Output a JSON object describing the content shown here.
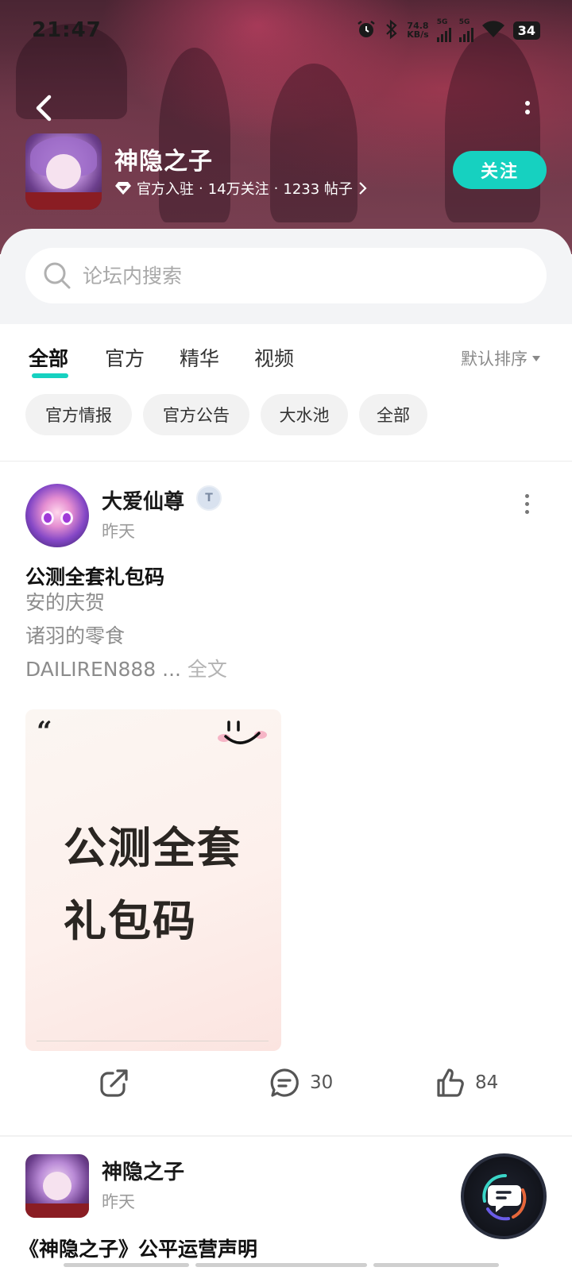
{
  "status_bar": {
    "time": "21:47",
    "net_speed_value": "74.8",
    "net_speed_unit": "KB/s",
    "sim1": "5G",
    "sim2": "5G",
    "battery": "34",
    "icons": [
      "alarm-icon",
      "bluetooth-icon",
      "signal-icon",
      "wifi-icon",
      "battery-icon"
    ]
  },
  "header": {
    "back_icon": "chevron-left-icon",
    "more_icon": "more-vertical-icon"
  },
  "forum": {
    "name": "神隐之子",
    "official_label": "官方入驻",
    "followers": "14万关注",
    "posts": "1233 帖子",
    "sep": "·",
    "follow_label": "关注"
  },
  "search": {
    "placeholder": "论坛内搜索"
  },
  "tabs": {
    "items": [
      "全部",
      "官方",
      "精华",
      "视频"
    ],
    "active_index": 0,
    "sort_label": "默认排序"
  },
  "chips": [
    "官方情报",
    "官方公告",
    "大水池",
    "全部"
  ],
  "post": {
    "author": "大爱仙尊",
    "badge": "T",
    "time": "昨天",
    "title": "公测全套礼包码",
    "lines": [
      "安的庆贺",
      "诸羽的零食",
      "DAILIREN888"
    ],
    "ellipsis": " ... ",
    "full_text_label": "全文",
    "image_text_1": "公测全套",
    "image_text_2": "礼包码",
    "image_quote": "“",
    "share_icon": "share-icon",
    "comment_count": "30",
    "like_count": "84"
  },
  "post2": {
    "author": "神隐之子",
    "time": "昨天",
    "title": "《神隐之子》公平运营声明"
  },
  "colors": {
    "accent": "#16d1c0",
    "banner": "#6a3546"
  }
}
